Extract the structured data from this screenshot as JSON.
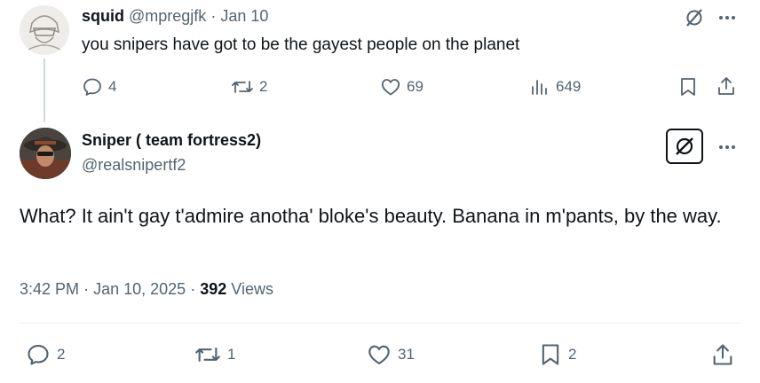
{
  "reply_to": {
    "display_name": "squid",
    "handle": "@mpregjfk",
    "separator": "·",
    "date": "Jan 10",
    "text": "you snipers have got to be the gayest people on the planet",
    "stats": {
      "replies": "4",
      "reposts": "2",
      "likes": "69",
      "views": "649"
    }
  },
  "main": {
    "display_name": "Sniper ( team fortress2)",
    "handle": "@realsnipertf2",
    "text": "What? It ain't gay t'admire anotha' bloke's beauty. Banana in m'pants, by the way.",
    "meta": {
      "time": "3:42 PM",
      "separator": "·",
      "date": "Jan 10, 2025",
      "views_count": "392",
      "views_label": "Views"
    },
    "stats": {
      "replies": "2",
      "reposts": "1",
      "likes": "31",
      "bookmarks": "2"
    }
  },
  "colors": {
    "text": "#0f1419",
    "muted": "#536471",
    "divider": "#eff3f4",
    "thread_line": "#cfd9de"
  }
}
